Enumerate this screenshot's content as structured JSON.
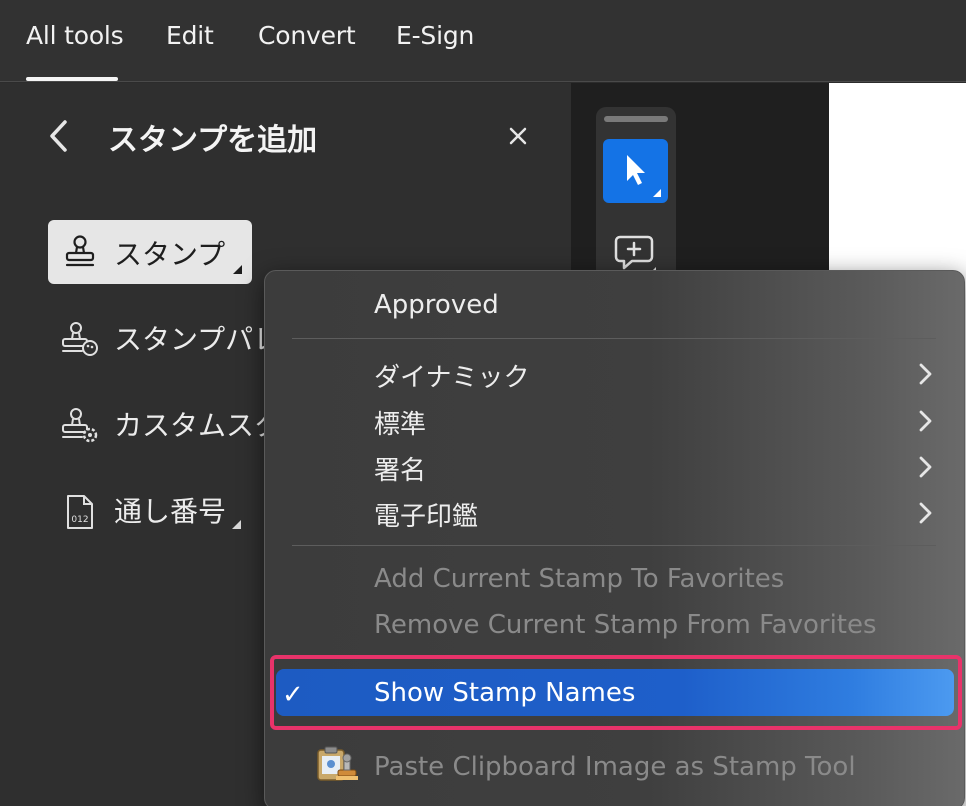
{
  "tabs": [
    "All tools",
    "Edit",
    "Convert",
    "E-Sign"
  ],
  "panel": {
    "title": "スタンプを追加",
    "back_icon": "chevron-left-icon",
    "close_icon": "close-icon",
    "stamp_button": "スタンプ",
    "items": [
      "スタンプパレ",
      "カスタムスタ",
      "通し番号"
    ]
  },
  "toolbar": {
    "select_icon": "cursor-arrow-icon",
    "comment_icon": "add-comment-icon"
  },
  "menu": {
    "approved": "Approved",
    "submenus": [
      "ダイナミック",
      "標準",
      "署名",
      "電子印鑑"
    ],
    "add_favorite": "Add Current Stamp To Favorites",
    "remove_favorite": "Remove Current Stamp From Favorites",
    "show_names": "Show Stamp Names",
    "checkmark": "✓",
    "paste_clipboard": "Paste Clipboard Image as Stamp Tool"
  },
  "colors": {
    "accent": "#1473e6",
    "highlight_frame": "#e8336a",
    "menu_highlight": "#1e5fca"
  }
}
